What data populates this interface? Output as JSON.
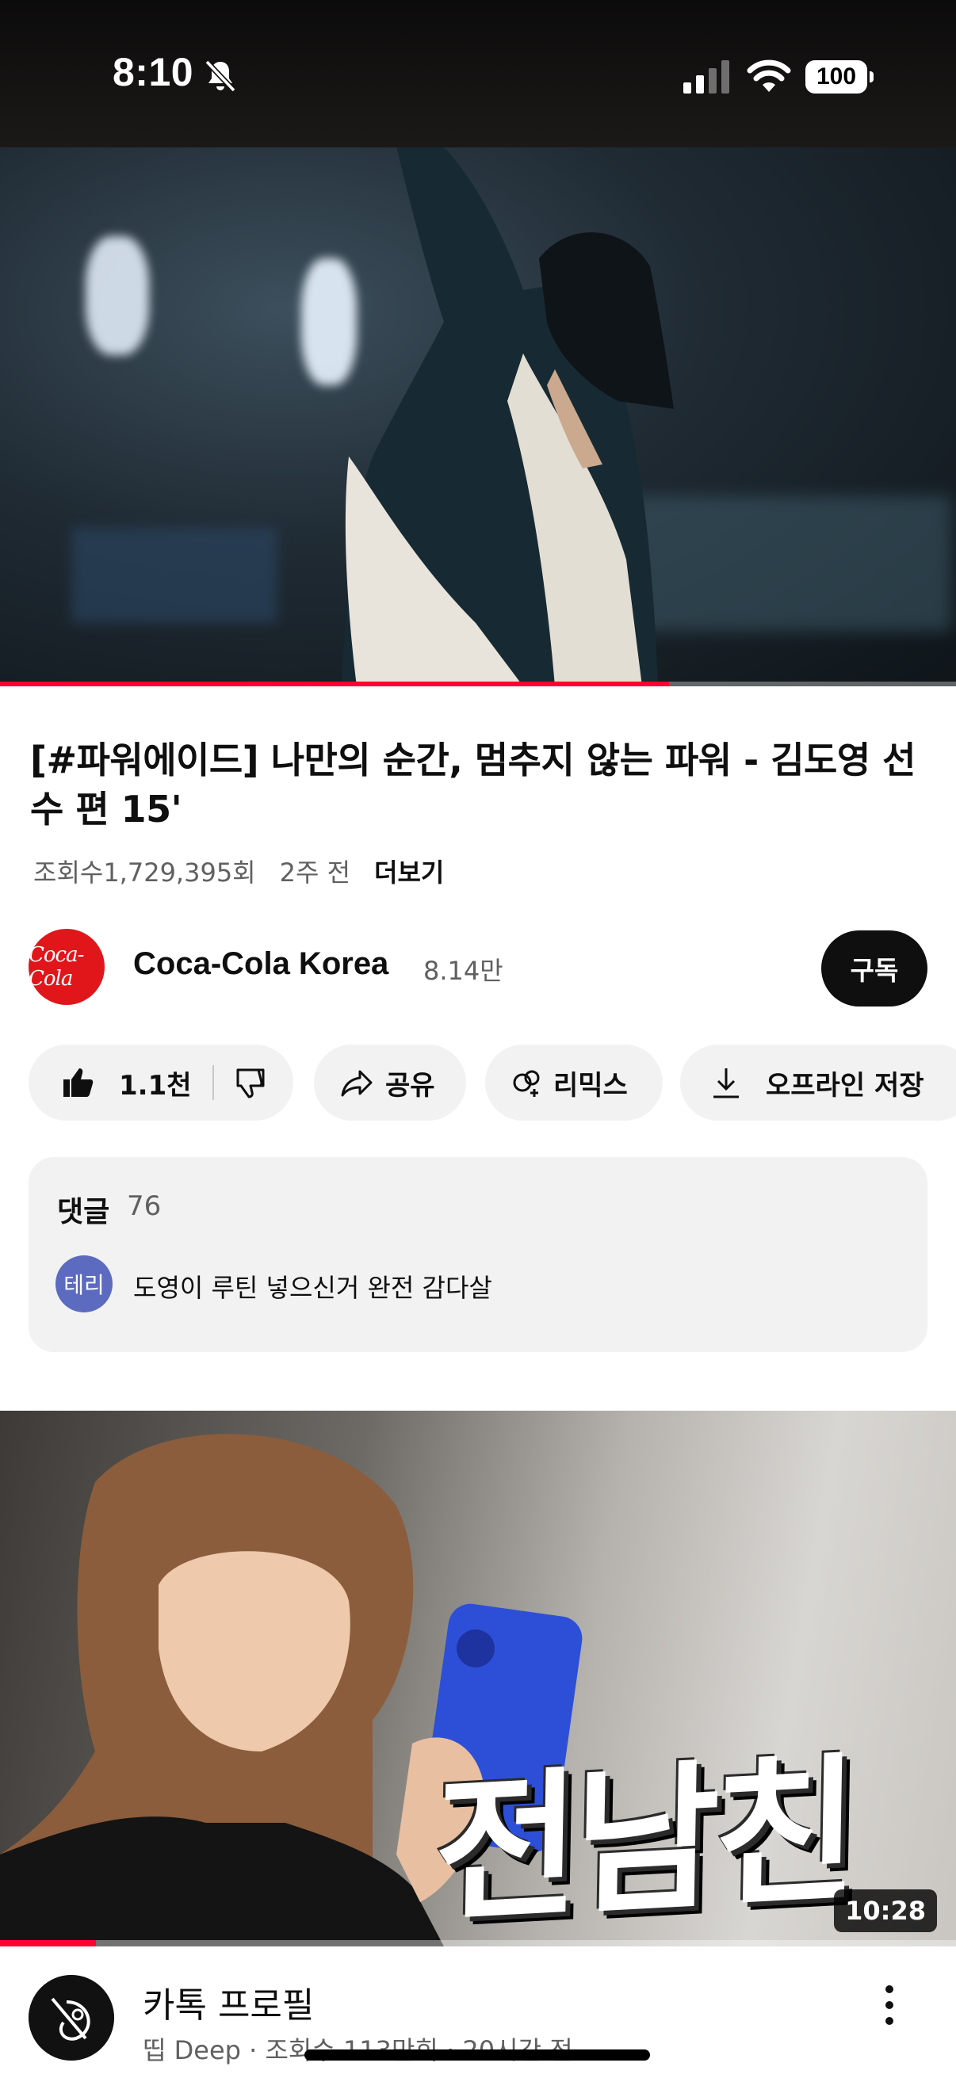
{
  "status_bar": {
    "time": "8:10",
    "battery": "100"
  },
  "player": {
    "progress_fraction": 0.7
  },
  "video": {
    "title": "[#파워에이드] 나만의 순간, 멈추지 않는 파워 - 김도영 선수 편 15'",
    "views": "조회수1,729,395회",
    "age": "2주 전",
    "more_label": "더보기"
  },
  "channel": {
    "name": "Coca-Cola Korea",
    "subscribers": "8.14만",
    "subscribe_label": "구독",
    "logo_text": "Coca-Cola"
  },
  "actions": {
    "like_count": "1.1천",
    "share_label": "공유",
    "remix_label": "리믹스",
    "offline_label": "오프라인 저장"
  },
  "comments": {
    "header": "댓글",
    "count": "76",
    "top_comment": {
      "avatar_text": "테리",
      "text": "도영이 루틴 넣으신거 완전 감다살"
    }
  },
  "next_video": {
    "thumbnail_text": "전남친",
    "duration": "10:28",
    "watched_fraction": 0.1,
    "title": "카톡 프로필",
    "meta": "띱 Deep · 조회수 113만회 · 20시간 전"
  },
  "colors": {
    "accent": "#ff0033",
    "coca_red": "#e0161b",
    "chip_bg": "#f2f2f2"
  }
}
